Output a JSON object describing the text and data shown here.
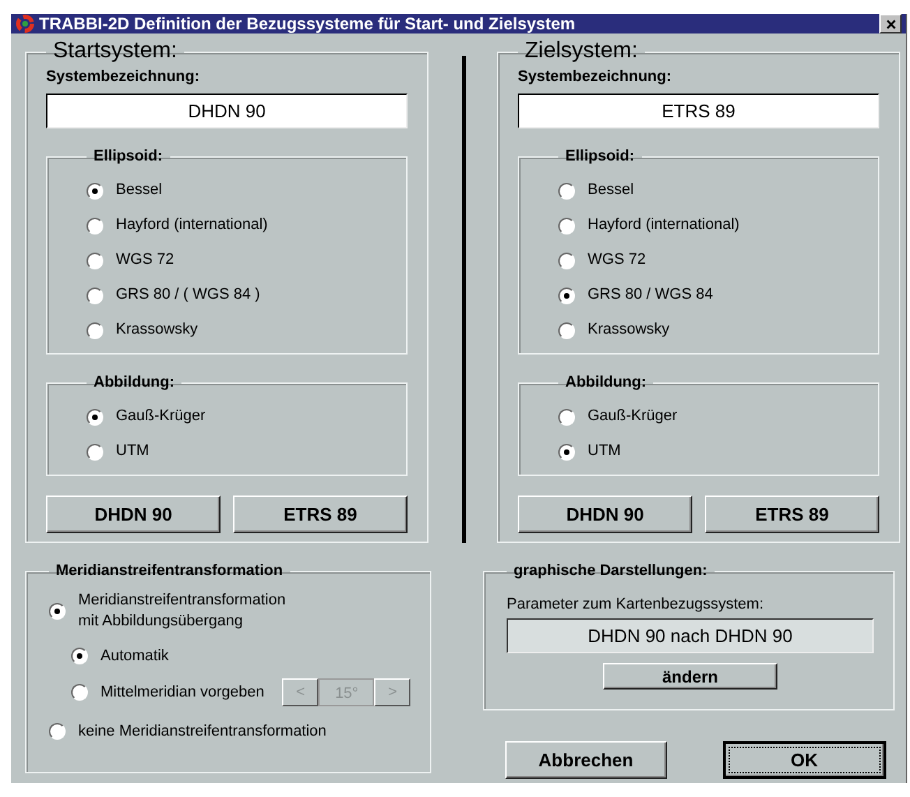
{
  "window": {
    "title": "TRABBI-2D Definition der Bezugssysteme für Start- und Zielsystem"
  },
  "systems": [
    {
      "title": "Startsystem:",
      "name_label": "Systembezeichnung:",
      "name_value": "DHDN 90",
      "ellipsoid": {
        "label": "Ellipsoid:",
        "options": [
          {
            "label": "Bessel",
            "selected": true
          },
          {
            "label": "Hayford (international)",
            "selected": false
          },
          {
            "label": "WGS 72",
            "selected": false
          },
          {
            "label": "GRS 80 / ( WGS 84 )",
            "selected": false
          },
          {
            "label": "Krassowsky",
            "selected": false
          }
        ]
      },
      "projection": {
        "label": "Abbildung:",
        "options": [
          {
            "label": "Gauß-Krüger",
            "selected": true
          },
          {
            "label": "UTM",
            "selected": false
          }
        ]
      },
      "buttons": [
        "DHDN 90",
        "ETRS 89"
      ]
    },
    {
      "title": "Zielsystem:",
      "name_label": "Systembezeichnung:",
      "name_value": "ETRS 89",
      "ellipsoid": {
        "label": "Ellipsoid:",
        "options": [
          {
            "label": "Bessel",
            "selected": false
          },
          {
            "label": "Hayford (international)",
            "selected": false
          },
          {
            "label": "WGS 72",
            "selected": false
          },
          {
            "label": "GRS 80 / WGS 84",
            "selected": true
          },
          {
            "label": "Krassowsky",
            "selected": false
          }
        ]
      },
      "projection": {
        "label": "Abbildung:",
        "options": [
          {
            "label": "Gauß-Krüger",
            "selected": false
          },
          {
            "label": "UTM",
            "selected": true
          }
        ]
      },
      "buttons": [
        "DHDN 90",
        "ETRS 89"
      ]
    }
  ],
  "meridian": {
    "title": "Meridianstreifentransformation",
    "options": [
      {
        "label": "Meridianstreifentransformation\nmit Abbildungsübergang",
        "selected": true,
        "children": [
          {
            "label": "Automatik",
            "selected": true,
            "kind": "plain"
          },
          {
            "label": "Mittelmeridian vorgeben",
            "selected": false,
            "kind": "spinner",
            "spinner": {
              "prev": "<",
              "value": "15°",
              "next": ">",
              "disabled": true
            }
          }
        ]
      },
      {
        "label": "keine Meridianstreifentransformation",
        "selected": false
      }
    ]
  },
  "graphics": {
    "title": "graphische Darstellungen:",
    "label": "Parameter zum Kartenbezugssystem:",
    "value": "DHDN 90 nach DHDN 90",
    "button": "ändern"
  },
  "buttons": [
    {
      "label": "Abbrechen",
      "default": false
    },
    {
      "label": "OK",
      "default": true
    }
  ]
}
